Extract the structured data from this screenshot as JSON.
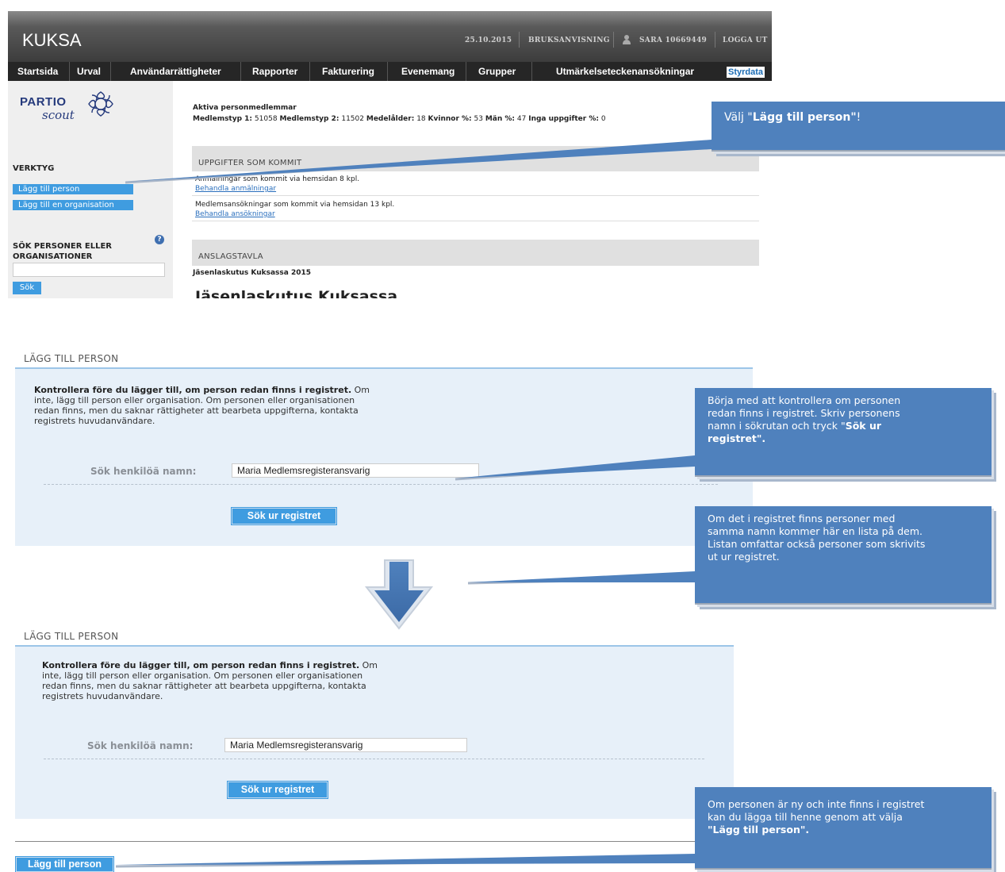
{
  "header": {
    "app_name": "KUKSA",
    "date": "25.10.2015",
    "manual": "BRUKSANVISNING",
    "user": "SARA 10669449",
    "logout": "LOGGA UT"
  },
  "nav": [
    "Startsida",
    "Urval",
    "Användarrättigheter",
    "Rapporter",
    "Fakturering",
    "Evenemang",
    "Grupper",
    "Utmärkelseteckenansökningar",
    "Styrdata"
  ],
  "sidebar": {
    "logo_top": "PARTIO",
    "logo_bottom": "scout",
    "tools_heading": "VERKTYG",
    "tools": [
      "Lägg till person",
      "Lägg till en organisation"
    ],
    "search_heading_1": "SÖK PERSONER ELLER",
    "search_heading_2": "ORGANISATIONER",
    "help_symbol": "?",
    "search_button": "Sök"
  },
  "main": {
    "stats_title": "Aktiva personmedlemmar",
    "stats": [
      {
        "label": "Medlemstyp 1:",
        "value": "51058"
      },
      {
        "label": "Medlemstyp 2:",
        "value": "11502"
      },
      {
        "label": "Medelålder:",
        "value": "18"
      },
      {
        "label": "Kvinnor %:",
        "value": "53"
      },
      {
        "label": "Män %:",
        "value": "47"
      },
      {
        "label": "Inga uppgifter %:",
        "value": "0"
      }
    ],
    "incoming_heading": "UPPGIFTER SOM KOMMIT",
    "registrations_text": "Anmälningar som kommit via hemsidan 8 kpl.",
    "registrations_link": "Behandla anmälningar",
    "applications_text": "Medlemsansökningar som kommit via hemsidan  13 kpl.",
    "applications_link": "Behandla ansökningar",
    "board_heading": "ANSLAGSTAVLA",
    "board_subtitle": "Jäsenlaskutus Kuksassa 2015",
    "board_title": "Jäsenlaskutus Kuksassa"
  },
  "callouts": {
    "c1_pre": "Välj \"",
    "c1_bold": "Lägg till person\"",
    "c1_post": "!",
    "c2_line1": "Börja med att kontrollera om personen",
    "c2_line2": "redan finns i registret. Skriv personens",
    "c2_line3_pre": "namn i sökrutan och tryck \"",
    "c2_line3_bold": "Sök ur",
    "c2_line4_bold": "registret\".",
    "c3_line1": "Om det i registret finns personer med",
    "c3_line2": "samma namn kommer här en lista på dem.",
    "c3_line3": "Listan omfattar också personer som skrivits",
    "c3_line4": "ut ur registret.",
    "c4_line1": "Om personen är ny och inte finns i registret",
    "c4_line2": "kan du lägga till henne genom att välja",
    "c4_line3_bold": "\"Lägg till person\"."
  },
  "add_person": {
    "title": "LÄGG TILL PERSON",
    "intro_bold": "Kontrollera före du lägger till, om person redan finns i registret.",
    "intro_tail": " Om",
    "intro_line2": "inte, lägg till person eller organisation. Om personen eller organisationen",
    "intro_line3": "redan finns, men du saknar rättigheter att bearbeta uppgifterna, kontakta",
    "intro_line4": "registrets huvudanvändare.",
    "search_label": "Sök henkilöä namn:",
    "search_value": "Maria Medlemsregisteransvarig",
    "search_button": "Sök ur registret",
    "add_button": "Lägg till person"
  },
  "colors": {
    "callout": "#4f81bd",
    "button": "#3f9ce0",
    "panel": "#e7f0f9",
    "link": "#2a6fbd"
  }
}
